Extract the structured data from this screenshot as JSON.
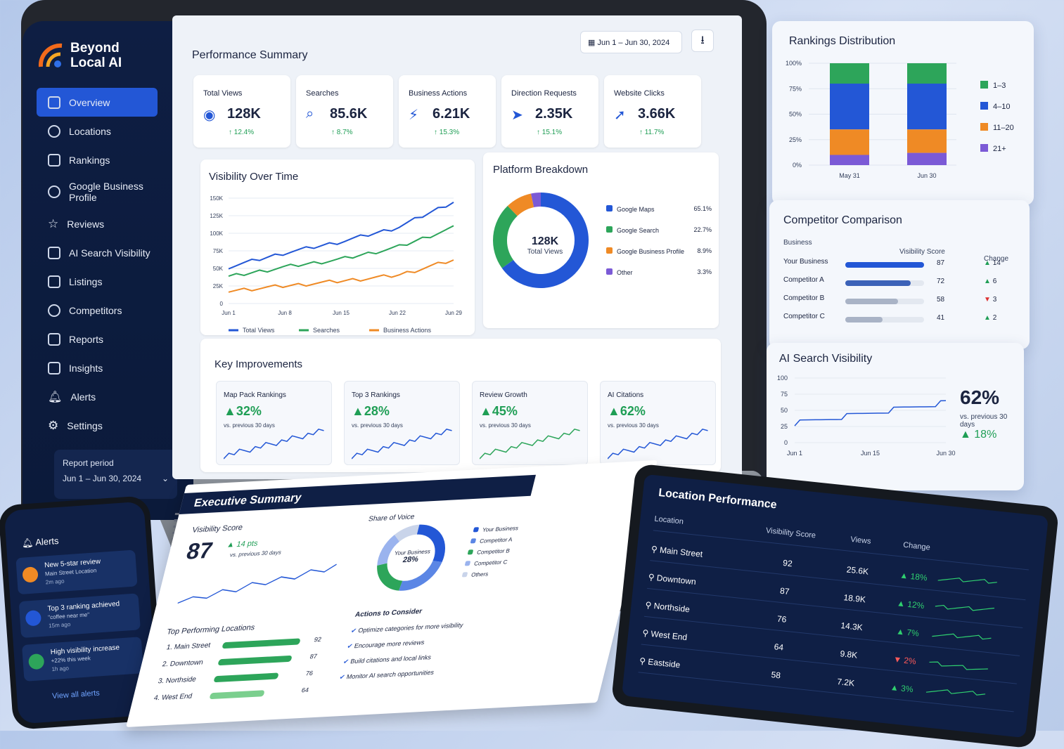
{
  "brand": {
    "name_line1": "Beyond",
    "name_line2": "Local AI"
  },
  "nav": [
    {
      "label": "Overview"
    },
    {
      "label": "Locations"
    },
    {
      "label": "Rankings"
    },
    {
      "label": "Google Business Profile"
    },
    {
      "label": "Reviews"
    },
    {
      "label": "AI Search Visibility"
    },
    {
      "label": "Listings"
    },
    {
      "label": "Competitors"
    },
    {
      "label": "Reports"
    },
    {
      "label": "Insights"
    },
    {
      "label": "Alerts"
    },
    {
      "label": "Settings"
    }
  ],
  "report_period": {
    "label": "Report period",
    "value": "Jun 1 – Jun 30, 2024"
  },
  "summary": {
    "title": "Performance Summary",
    "date_range": "Jun 1 – Jun 30, 2024"
  },
  "kpis": [
    {
      "label": "Total Views",
      "value": "128K",
      "delta": "12.4%",
      "icon": "eye-icon"
    },
    {
      "label": "Searches",
      "value": "85.6K",
      "delta": "8.7%",
      "icon": "search-icon"
    },
    {
      "label": "Business Actions",
      "value": "6.21K",
      "delta": "15.3%",
      "icon": "bolt-icon"
    },
    {
      "label": "Direction Requests",
      "value": "2.35K",
      "delta": "15.1%",
      "icon": "navigation-icon"
    },
    {
      "label": "Website Clicks",
      "value": "3.66K",
      "delta": "11.7%",
      "icon": "cursor-icon"
    }
  ],
  "visibility": {
    "title": "Visibility Over Time",
    "y_ticks": [
      "150K",
      "125K",
      "100K",
      "75K",
      "50K",
      "25K",
      "0"
    ],
    "x_ticks": [
      "Jun 1",
      "Jun 8",
      "Jun 15",
      "Jun 22",
      "Jun 29"
    ],
    "legend": [
      "Total Views",
      "Searches",
      "Business Actions"
    ]
  },
  "chart_data": [
    {
      "type": "line",
      "title": "Visibility Over Time",
      "x": [
        "Jun 1",
        "Jun 8",
        "Jun 15",
        "Jun 22",
        "Jun 29"
      ],
      "ylim": [
        0,
        150000
      ],
      "series": [
        {
          "name": "Total Views",
          "values": [
            52000,
            72000,
            88000,
            108000,
            145000
          ]
        },
        {
          "name": "Searches",
          "values": [
            38000,
            52000,
            63000,
            80000,
            108000
          ]
        },
        {
          "name": "Business Actions",
          "values": [
            18000,
            25000,
            32000,
            40000,
            62000
          ]
        }
      ]
    },
    {
      "type": "pie",
      "title": "Platform Breakdown",
      "categories": [
        "Google Maps",
        "Google Search",
        "Google Business Profile",
        "Other"
      ],
      "values": [
        65.1,
        22.7,
        8.9,
        3.3
      ]
    },
    {
      "type": "bar",
      "title": "Rankings Distribution",
      "categories": [
        "May 31",
        "Jun 30"
      ],
      "ylim": [
        0,
        100
      ],
      "series": [
        {
          "name": "1-3",
          "values": [
            20,
            20
          ]
        },
        {
          "name": "4-10",
          "values": [
            45,
            45
          ]
        },
        {
          "name": "11-20",
          "values": [
            25,
            23
          ]
        },
        {
          "name": "21+",
          "values": [
            10,
            12
          ]
        }
      ]
    }
  ],
  "platform": {
    "title": "Platform Breakdown",
    "center_value": "128K",
    "center_label": "Total Views",
    "items": [
      {
        "name": "Google Maps",
        "pct": "65.1%",
        "color": "#2357d6"
      },
      {
        "name": "Google Search",
        "pct": "22.7%",
        "color": "#2da55a"
      },
      {
        "name": "Google Business Profile",
        "pct": "8.9%",
        "color": "#ef8a25"
      },
      {
        "name": "Other",
        "pct": "3.3%",
        "color": "#7b5ad6"
      }
    ]
  },
  "improvements": {
    "title": "Key Improvements",
    "items": [
      {
        "label": "Map Pack Rankings",
        "value": "32%",
        "note": "vs. previous 30 days"
      },
      {
        "label": "Top 3 Rankings",
        "value": "28%",
        "note": "vs. previous 30 days"
      },
      {
        "label": "Review Growth",
        "value": "45%",
        "note": "vs. previous 30 days"
      },
      {
        "label": "AI Citations",
        "value": "62%",
        "note": "vs. previous 30 days"
      }
    ]
  },
  "rankings": {
    "title": "Rankings Distribution",
    "y_ticks": [
      "100%",
      "75%",
      "50%",
      "25%",
      "0%"
    ],
    "x": [
      "May 31",
      "Jun 30"
    ],
    "legend": [
      "1–3",
      "4–10",
      "11–20",
      "21+"
    ]
  },
  "competitor": {
    "title": "Competitor Comparison",
    "col_business": "Business",
    "col_score": "Visibility Score",
    "col_change": "Change",
    "rows": [
      {
        "name": "Your Business",
        "score": "87",
        "change": "14",
        "dir": "up"
      },
      {
        "name": "Competitor A",
        "score": "72",
        "change": "6",
        "dir": "up"
      },
      {
        "name": "Competitor B",
        "score": "58",
        "change": "3",
        "dir": "down"
      },
      {
        "name": "Competitor C",
        "score": "41",
        "change": "2",
        "dir": "up"
      }
    ]
  },
  "ai_visibility": {
    "title": "AI Search Visibility",
    "value": "62%",
    "note": "vs. previous 30 days",
    "delta": "18%",
    "y_ticks": [
      "100",
      "75",
      "50",
      "25",
      "0"
    ],
    "x": [
      "Jun 1",
      "Jun 15",
      "Jun 30"
    ]
  },
  "alerts": {
    "title": "Alerts",
    "items": [
      {
        "title": "New 5-star review",
        "sub": "Main Street Location",
        "time": "2m ago"
      },
      {
        "title": "Top 3 ranking achieved",
        "sub": "\"coffee near me\"",
        "time": "15m ago"
      },
      {
        "title": "High visibility increase",
        "sub": "+22% this week",
        "time": "1h ago"
      }
    ],
    "view_all": "View all alerts"
  },
  "exec": {
    "title": "Executive Summary",
    "score_label": "Visibility Score",
    "score": "87",
    "score_delta": "14 pts",
    "score_note": "vs. previous 30 days",
    "sov_title": "Share of Voice",
    "sov_center": "Your Business",
    "sov_pct": "28%",
    "sov_legend": [
      "Your Business",
      "Competitor A",
      "Competitor B",
      "Competitor C",
      "Others"
    ],
    "top_title": "Top Performing Locations",
    "top": [
      {
        "name": "1. Main Street",
        "v": "92"
      },
      {
        "name": "2. Downtown",
        "v": "87"
      },
      {
        "name": "3. Northside",
        "v": "76"
      },
      {
        "name": "4. West End",
        "v": "64"
      }
    ],
    "actions_title": "Actions to Consider",
    "actions": [
      "Optimize categories for more visibility",
      "Encourage more reviews",
      "Build citations and local links",
      "Monitor AI search opportunities"
    ]
  },
  "location_perf": {
    "title": "Location Performance",
    "cols": [
      "Location",
      "Visibility Score",
      "Views",
      "Change"
    ],
    "rows": [
      {
        "loc": "Main Street",
        "score": "92",
        "views": "25.6K",
        "change": "18%",
        "dir": "up"
      },
      {
        "loc": "Downtown",
        "score": "87",
        "views": "18.9K",
        "change": "12%",
        "dir": "up"
      },
      {
        "loc": "Northside",
        "score": "76",
        "views": "14.3K",
        "change": "7%",
        "dir": "up"
      },
      {
        "loc": "West End",
        "score": "64",
        "views": "9.8K",
        "change": "2%",
        "dir": "down"
      },
      {
        "loc": "Eastside",
        "score": "58",
        "views": "7.2K",
        "change": "3%",
        "dir": "up"
      }
    ]
  }
}
